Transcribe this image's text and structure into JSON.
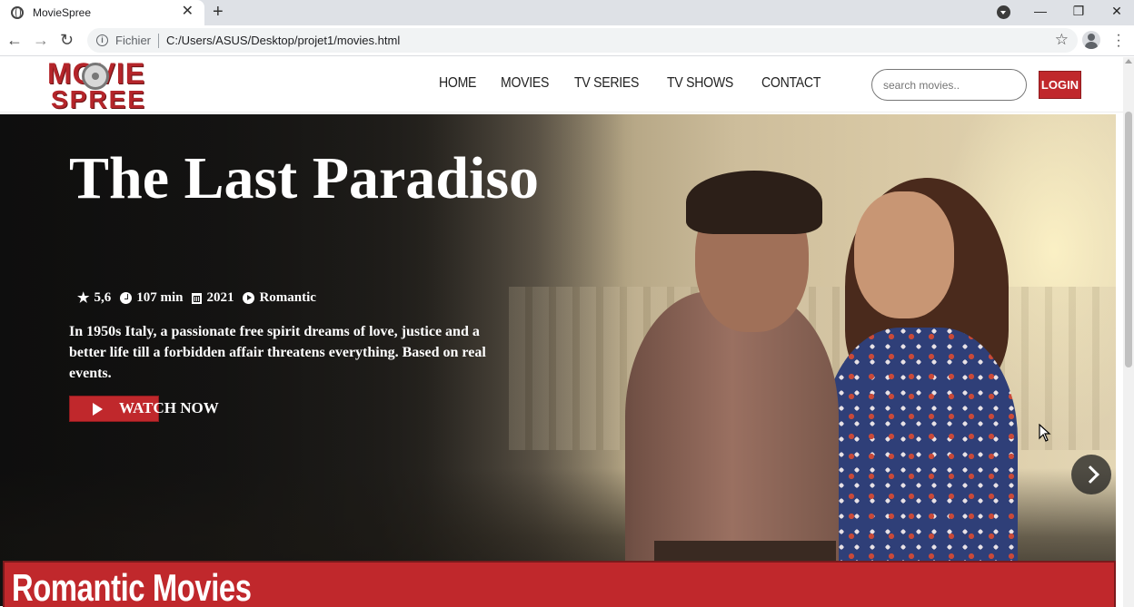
{
  "browser": {
    "tab_title": "MovieSpree",
    "tab_close": "✕",
    "new_tab": "+",
    "back": "←",
    "forward": "→",
    "reload": "↻",
    "scheme_label": "Fichier",
    "url": "C:/Users/ASUS/Desktop/projet1/movies.html",
    "window_controls": [
      "—",
      "❐",
      "✕"
    ]
  },
  "navbar": {
    "logo_word1": "MOVIE",
    "logo_word2": "SPREE",
    "links": [
      "HOME",
      "MOVIES",
      "TV SERIES",
      "TV SHOWS",
      "CONTACT"
    ],
    "search_placeholder": "search movies..",
    "login_label": "LOGIN"
  },
  "hero": {
    "title": "The Last Paradiso",
    "rating": "5,6",
    "duration": "107 min",
    "year": "2021",
    "genre": "Romantic",
    "description": "In 1950s Italy, a passionate free spirit dreams of love, justice and a better life till a forbidden affair threatens everything. Based on real events.",
    "watch_label": "WATCH NOW"
  },
  "section": {
    "title": "Romantic Movies"
  },
  "colors": {
    "accent": "#c0282c",
    "tabstrip": "#dee1e6"
  }
}
